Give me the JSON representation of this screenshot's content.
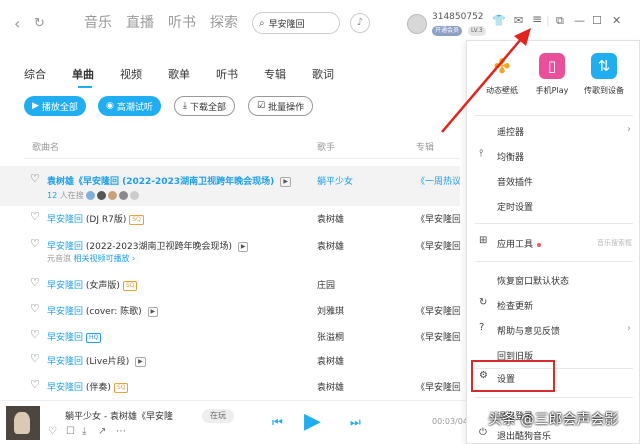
{
  "nav": {
    "back": "‹",
    "refresh": "↻"
  },
  "main_tabs": [
    "音乐",
    "直播",
    "听书",
    "探索"
  ],
  "search": {
    "value": "早安隆回"
  },
  "user": {
    "id": "314850752",
    "badge1": "开通会员",
    "badge2": "LV.3"
  },
  "sub_tabs": [
    "综合",
    "单曲",
    "视频",
    "歌单",
    "听书",
    "专辑",
    "歌词"
  ],
  "actions": {
    "play_all": "播放全部",
    "hires": "高潮试听",
    "download_all": "下载全部",
    "batch": "批量操作"
  },
  "table_header": {
    "song": "歌曲名",
    "artist": "歌手",
    "album": "专辑"
  },
  "rows": [
    {
      "title_lead": "袁树雄",
      "title": "《早安隆回 (2022-2023湖南卫视跨年晚会现场)",
      "artist": "躺平少女",
      "album": "《一周热议歌曲",
      "sub_count": "12",
      "sub_text": "人在搜"
    },
    {
      "title": "早安隆回",
      "suffix": "(DJ R7版)",
      "tag": "SQ",
      "artist": "袁树雄",
      "album": "《早安隆回"
    },
    {
      "title": "早安隆回",
      "suffix": "(2022-2023湖南卫视跨年晚会现场)",
      "artist": "袁树雄",
      "album": "《早安隆回",
      "sub_lead": "元音浪",
      "sub_text": "相关视频可播放 ›"
    },
    {
      "title": "早安隆回",
      "suffix": "(女声版)",
      "tag": "SQ",
      "artist": "庄园",
      "album": ""
    },
    {
      "title": "早安隆回",
      "suffix": "(cover: 陈歌)",
      "artist": "刘雅琪",
      "album": "《早安隆回【"
    },
    {
      "title": "早安隆回",
      "suffix": "",
      "tag": "HQ",
      "artist": "张溢桐",
      "album": "《早安隆回"
    },
    {
      "title": "早安隆回",
      "suffix": "(Live片段)",
      "artist": "袁树雄",
      "album": ""
    },
    {
      "title": "早安隆回",
      "suffix": "(伴奏)",
      "tag": "SQ",
      "artist": "袁树雄",
      "album": "《早安隆回"
    }
  ],
  "player": {
    "title": "躺平少女 - 袁树雄《早安隆",
    "status": "在玩",
    "time": "00:03/04"
  },
  "menu": {
    "top": [
      "动态壁纸",
      "手机Play",
      "传歌到设备"
    ],
    "items": [
      {
        "label": "遥控器"
      },
      {
        "label": "均衡器"
      },
      {
        "label": "音效插件"
      },
      {
        "label": "定时设置"
      },
      {
        "label": "应用工具",
        "ext": "音乐搜索框"
      },
      {
        "label": "恢复窗口默认状态"
      },
      {
        "label": "检查更新"
      },
      {
        "label": "帮助与意见反馈"
      },
      {
        "label": "回到旧版"
      },
      {
        "label": "设置"
      },
      {
        "label": "退出登录"
      },
      {
        "label": "退出酷狗音乐"
      }
    ]
  },
  "watermark": "头条 @三郎会声会影",
  "colors": {
    "accent": "#21aef0",
    "highlight_box": "#d92b2b",
    "arrow": "#e0241f"
  }
}
